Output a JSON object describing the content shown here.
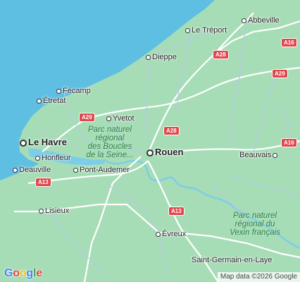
{
  "map": {
    "cities": {
      "le_treport": "Le Tréport",
      "abbeville": "Abbeville",
      "dieppe": "Dieppe",
      "fecamp": "Fécamp",
      "etretat": "Étretat",
      "yvetot": "Yvetot",
      "le_havre": "Le Havre",
      "honfleur": "Honfleur",
      "deauville": "Deauville",
      "pont_audemer": "Pont-Audemer",
      "rouen": "Rouen",
      "beauvais": "Beauvais",
      "lisieux": "Lisieux",
      "evreux": "Évreux",
      "saint_germain": "Saint-Germain-en-Laye"
    },
    "parks": {
      "seine_line1": "Parc naturel",
      "seine_line2": "régional",
      "seine_line3": "des Boucles",
      "seine_line4": "de la Seine...",
      "vexin_line1": "Parc naturel",
      "vexin_line2": "régional du",
      "vexin_line3": "Vexin français"
    },
    "roads": {
      "a28_north": "A28",
      "a16_north": "A16",
      "a29_east": "A29",
      "a29_west": "A29",
      "a28_rouen": "A28",
      "a16_beauvais": "A16",
      "a13_west": "A13",
      "a13_south": "A13"
    },
    "colors": {
      "sea": "#5fbfe3",
      "land": "#a6ddb6",
      "road_shield": "#e0474c",
      "park_text": "#2e7d4a"
    }
  },
  "branding": {
    "logo_letters": [
      "G",
      "o",
      "o",
      "g",
      "l",
      "e"
    ],
    "logo_colors": [
      "#4285F4",
      "#EA4335",
      "#FBBC05",
      "#4285F4",
      "#34A853",
      "#EA4335"
    ],
    "attribution": "Map data ©2026 Google"
  }
}
